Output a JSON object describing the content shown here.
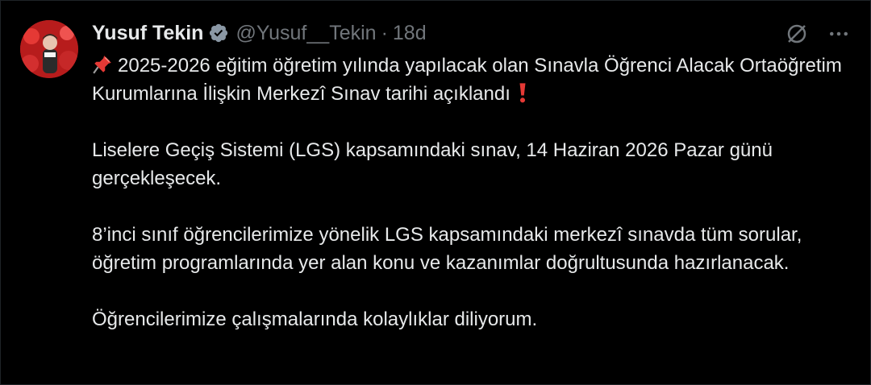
{
  "author": {
    "display_name": "Yusuf Tekin",
    "handle": "@Yusuf__Tekin",
    "separator": "·",
    "timestamp": "18d",
    "verified_icon": "verified-badge-icon"
  },
  "actions": {
    "grok_icon": "grok-icon",
    "more_icon": "more-icon"
  },
  "tweet": {
    "line1": "2025-2026 eğitim öğretim yılında yapılacak olan Sınavla Öğrenci Alacak Ortaöğretim Kurumlarına İlişkin Merkezî Sınav tarihi açıklandı",
    "para2": "Liselere Geçiş Sistemi (LGS) kapsamındaki sınav, 14 Haziran 2026 Pazar günü gerçekleşecek.",
    "para3": "8’inci sınıf öğrencilerimize yönelik LGS kapsamındaki merkezî sınavda tüm sorular, öğretim programlarında yer alan konu ve kazanımlar doğrultusunda hazırlanacak.",
    "para4": "Öğrencilerimize çalışmalarında kolaylıklar diliyorum.",
    "lead_emoji": "pushpin-icon",
    "trail_emoji": "exclamation-icon"
  },
  "colors": {
    "background": "#000000",
    "text": "#e7e9ea",
    "muted": "#71767b",
    "accent": "#1d9bf0"
  }
}
